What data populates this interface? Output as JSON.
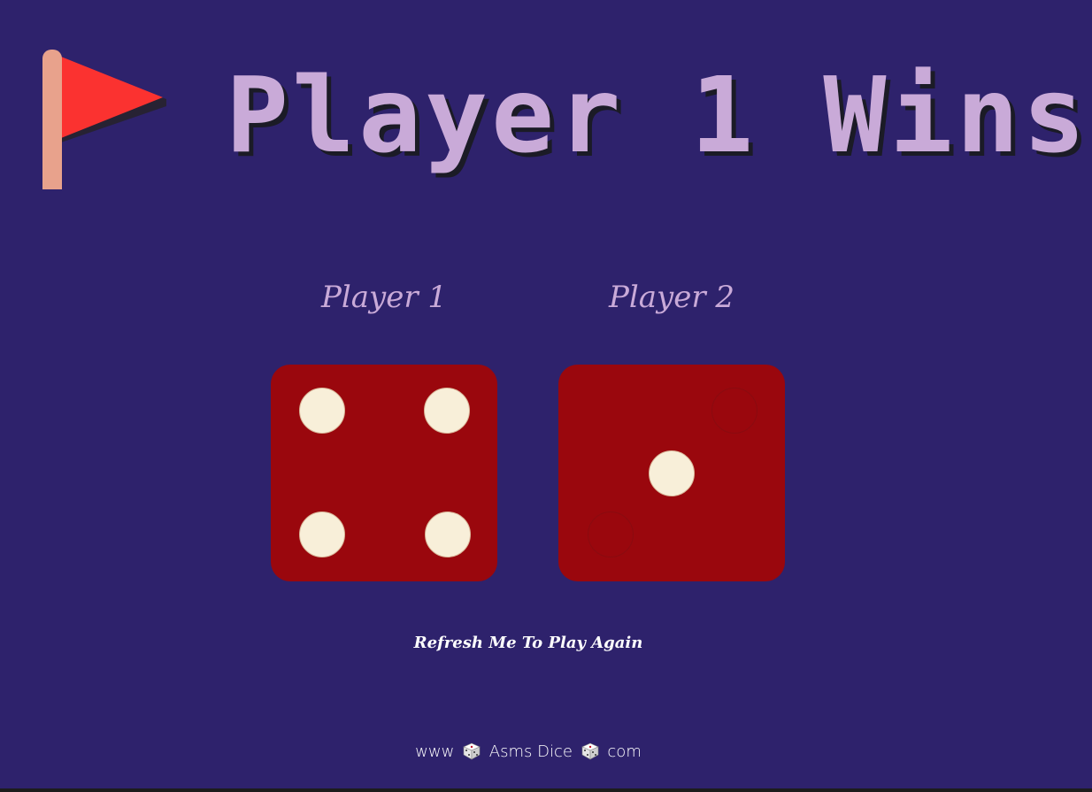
{
  "header": {
    "title": "Player 1 Wins",
    "icon": "flag-icon",
    "colors": {
      "background": "#2e226c",
      "title": "#c9aad8",
      "flag": "#fb3230",
      "flag_pole": "#e8a28c"
    }
  },
  "players": [
    {
      "label": "Player 1",
      "die_value": 4
    },
    {
      "label": "Player 2",
      "die_value": 1
    }
  ],
  "dice": {
    "face_color": "#9a070d",
    "pip_color": "#f8efd9"
  },
  "actions": {
    "refresh_text": "Refresh Me To Play Again"
  },
  "footer": {
    "prefix": "www",
    "icon": "dice-icon",
    "brand": "Asms Dice",
    "suffix": "com"
  }
}
